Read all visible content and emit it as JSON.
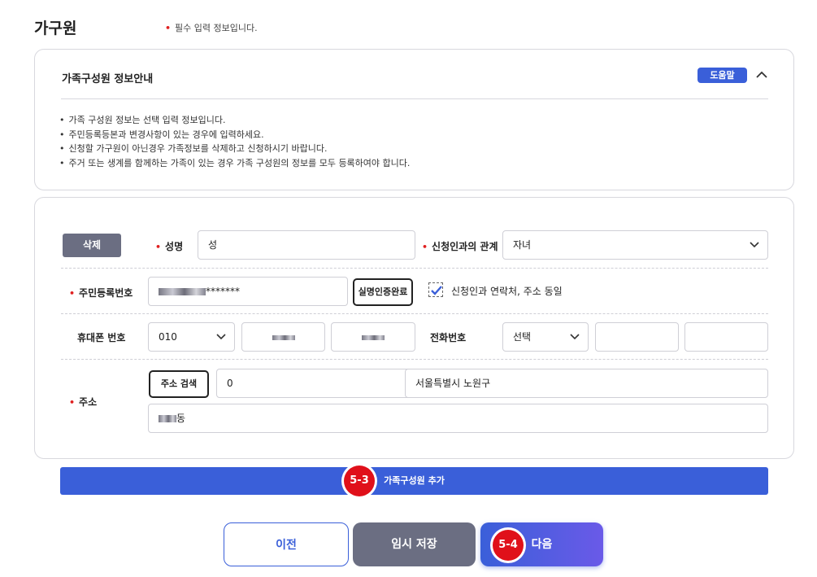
{
  "page": {
    "title": "가구원",
    "required_note": "필수 입력 정보입니다."
  },
  "info": {
    "title": "가족구성원 정보안내",
    "help_label": "도움말",
    "items": [
      "가족 구성원 정보는 선택 입력 정보입니다.",
      "주민등록등본과 변경사항이 있는 경우에 입력하세요.",
      "신청할 가구원이 아닌경우 가족정보를 삭제하고 신청하시기 바랍니다.",
      "주거 또는 생계를 함께하는 가족이 있는 경우 가족 구성원의 정보를 모두 등록하여야 합니다."
    ]
  },
  "form": {
    "delete_label": "삭제",
    "name_label": "성명",
    "name_value": "성",
    "relation_label": "신청인과의 관계",
    "relation_value": "자녀",
    "rrn_label": "주민등록번호",
    "rrn_suffix": "*******",
    "verify_label": "실명인증완료",
    "same_label": "신청인과 연락처, 주소 동일",
    "same_checked": true,
    "mobile_label": "휴대폰 번호",
    "mobile_prefix": "010",
    "phone_label": "전화번호",
    "phone_select": "선택",
    "address_label": "주소",
    "address_search_label": "주소 검색",
    "zip_value": "0",
    "address1_value": "서울특별시 노원구",
    "address2_suffix": "동"
  },
  "actions": {
    "add_member_label": "가족구성원 추가",
    "prev_label": "이전",
    "temp_save_label": "임시 저장",
    "next_label": "다음"
  },
  "annotations": {
    "step_add": "5-3",
    "step_next": "5-4"
  },
  "colors": {
    "primary": "#3a5fd9",
    "required_dot": "#e02020",
    "step_badge": "#e0101a",
    "gray_button": "#6b6e82"
  },
  "icons": {
    "help_toggle": "chevron-up-icon",
    "select_arrow": "chevron-down-icon",
    "checkbox": "checkmark-icon"
  }
}
